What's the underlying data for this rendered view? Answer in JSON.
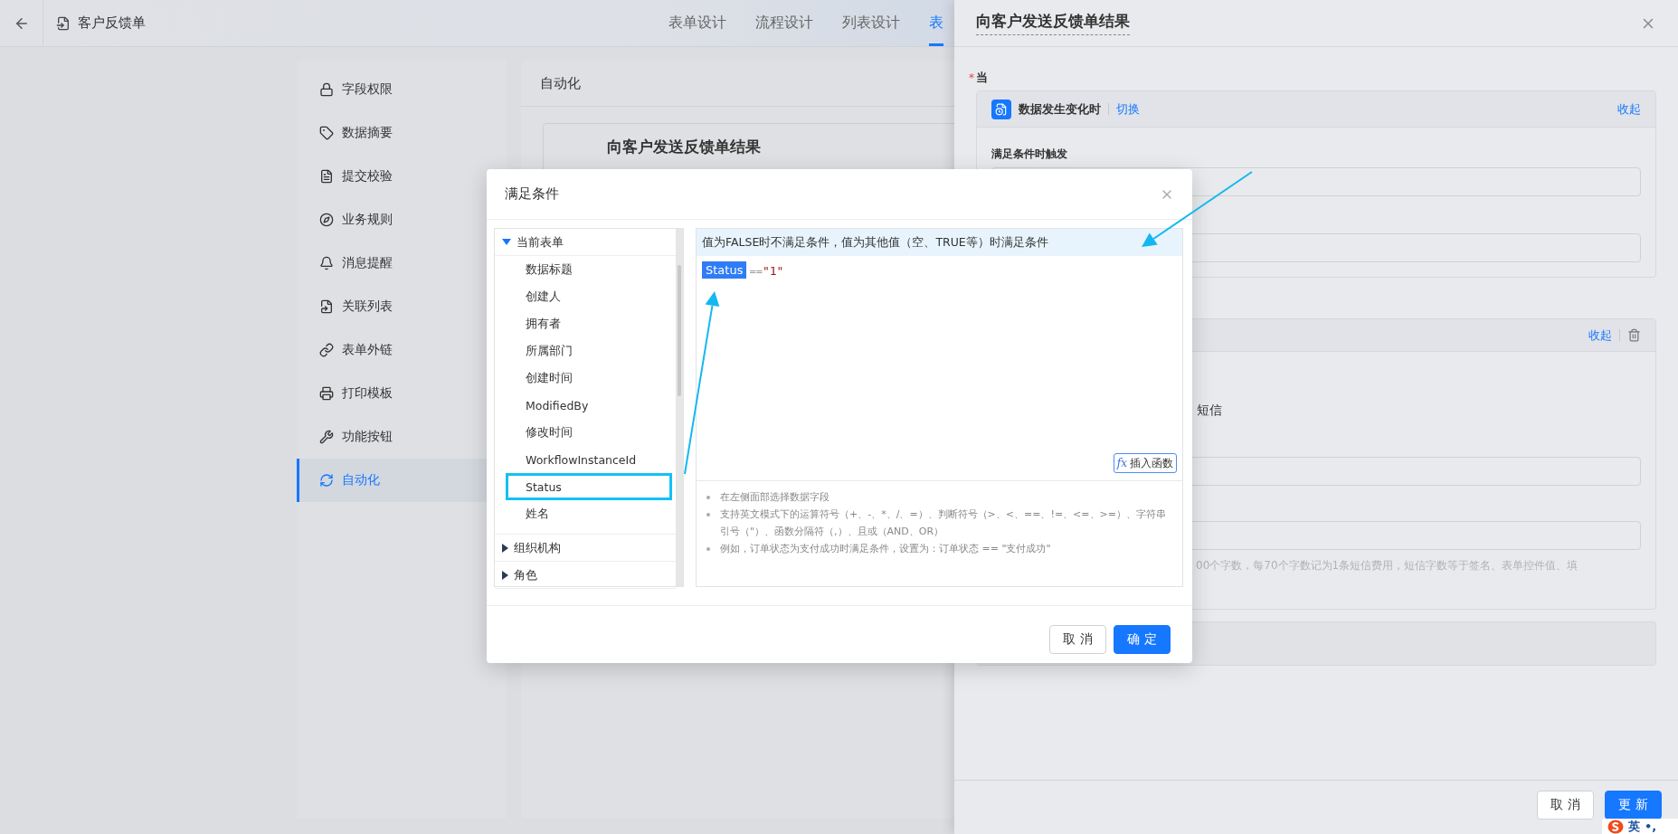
{
  "topbar": {
    "title": "客户反馈单",
    "tabs": [
      {
        "label": "表单设计",
        "selected": false
      },
      {
        "label": "流程设计",
        "selected": false
      },
      {
        "label": "列表设计",
        "selected": false
      },
      {
        "label": "表",
        "selected": true
      }
    ]
  },
  "settings_menu": {
    "items": [
      {
        "label": "字段权限",
        "selected": false
      },
      {
        "label": "数据摘要",
        "selected": false
      },
      {
        "label": "提交校验",
        "selected": false
      },
      {
        "label": "业务规则",
        "selected": false
      },
      {
        "label": "消息提醒",
        "selected": false
      },
      {
        "label": "关联列表",
        "selected": false
      },
      {
        "label": "表单外链",
        "selected": false
      },
      {
        "label": "打印模板",
        "selected": false
      },
      {
        "label": "功能按钮",
        "selected": false
      },
      {
        "label": "自动化",
        "selected": true
      }
    ]
  },
  "content": {
    "title": "自动化",
    "card_title": "向客户发送反馈单结果"
  },
  "modal": {
    "title": "满足条件",
    "tree": [
      {
        "label": "当前表单",
        "expanded": true,
        "children": [
          {
            "label": "数据标题",
            "highlighted": false
          },
          {
            "label": "创建人",
            "highlighted": false
          },
          {
            "label": "拥有者",
            "highlighted": false
          },
          {
            "label": "所属部门",
            "highlighted": false
          },
          {
            "label": "创建时间",
            "highlighted": false
          },
          {
            "label": "ModifiedBy",
            "highlighted": false
          },
          {
            "label": "修改时间",
            "highlighted": false
          },
          {
            "label": "WorkflowInstanceId",
            "highlighted": false
          },
          {
            "label": "Status",
            "highlighted": true
          },
          {
            "label": "姓名",
            "highlighted": false
          }
        ]
      },
      {
        "label": "组织机构",
        "expanded": false
      },
      {
        "label": "角色",
        "expanded": false
      }
    ],
    "hint": "值为FALSE时不满足条件，值为其他值（空、TRUE等）时满足条件",
    "formula": {
      "field": "Status",
      "operator": "==",
      "value": "\"1\""
    },
    "insert_function": {
      "symbol": "fx",
      "label": "插入函数"
    },
    "notes": [
      "在左侧面部选择数据字段",
      "支持英文模式下的运算符号（+、-、*、/、=）、判断符号（>、<、==、!=、<=、>=）、字符串引号（\"）、函数分隔符（,）、且或（AND、OR）",
      "例如，订单状态为支付成功时满足条件，设置为：订单状态 == \"支付成功\""
    ],
    "buttons": {
      "cancel": "取 消",
      "ok": "确 定"
    }
  },
  "drawer": {
    "title": "向客户发送反馈单结果",
    "required_mark": "*",
    "when_label": "当",
    "trigger": {
      "title": "数据发生变化时",
      "switch": "切换",
      "collapse": "收起",
      "condition_label": "满足条件时触发"
    },
    "action": {
      "collapse": "收起",
      "text": "短信",
      "hint": "00个字数，每70个字数记为1条短信费用，短信字数等于签名、表单控件值、填"
    },
    "buttons": {
      "cancel": "取 消",
      "ok": "更 新"
    }
  },
  "ime": {
    "mode": "英",
    "punctuation": "•,"
  }
}
